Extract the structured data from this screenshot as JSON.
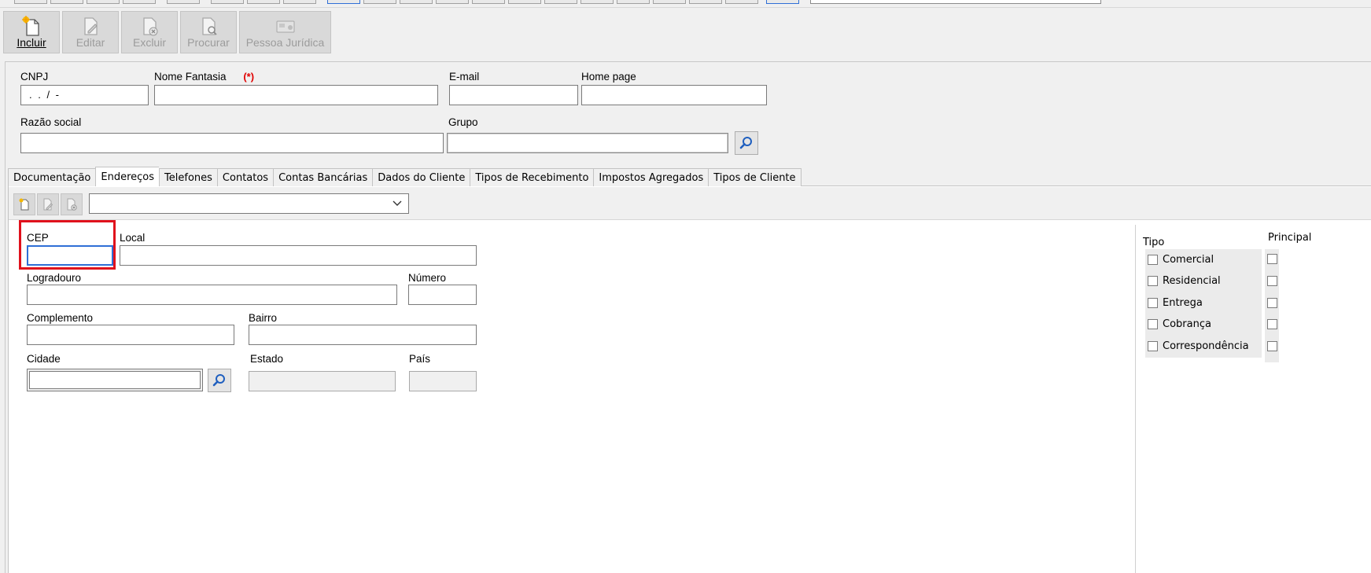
{
  "toolbar": {
    "incluir": "Incluir",
    "editar": "Editar",
    "excluir": "Excluir",
    "procurar": "Procurar",
    "pessoa_juridica": "Pessoa Jurídica"
  },
  "form": {
    "cnpj_label": "CNPJ",
    "cnpj_value": ". . /  -",
    "nome_fantasia_label": "Nome Fantasia",
    "required_mark": "(*)",
    "email_label": "E-mail",
    "home_page_label": "Home page",
    "razao_social_label": "Razão social",
    "grupo_label": "Grupo"
  },
  "tabs": [
    {
      "label": "Documentação"
    },
    {
      "label": "Endereços"
    },
    {
      "label": "Telefones"
    },
    {
      "label": "Contatos"
    },
    {
      "label": "Contas Bancárias"
    },
    {
      "label": "Dados do Cliente"
    },
    {
      "label": "Tipos de Recebimento"
    },
    {
      "label": "Impostos Agregados"
    },
    {
      "label": "Tipos de Cliente"
    }
  ],
  "address": {
    "cep_label": "CEP",
    "local_label": "Local",
    "logradouro_label": "Logradouro",
    "numero_label": "Número",
    "complemento_label": "Complemento",
    "bairro_label": "Bairro",
    "cidade_label": "Cidade",
    "estado_label": "Estado",
    "pais_label": "País"
  },
  "tipo": {
    "header": "Tipo",
    "principal_header": "Principal",
    "items": [
      {
        "label": "Comercial"
      },
      {
        "label": "Residencial"
      },
      {
        "label": "Entrega"
      },
      {
        "label": "Cobrança"
      },
      {
        "label": "Correspondência"
      }
    ]
  },
  "colors": {
    "highlight": "#e0111c",
    "focus": "#2f6fd6",
    "required": "#e00000"
  }
}
